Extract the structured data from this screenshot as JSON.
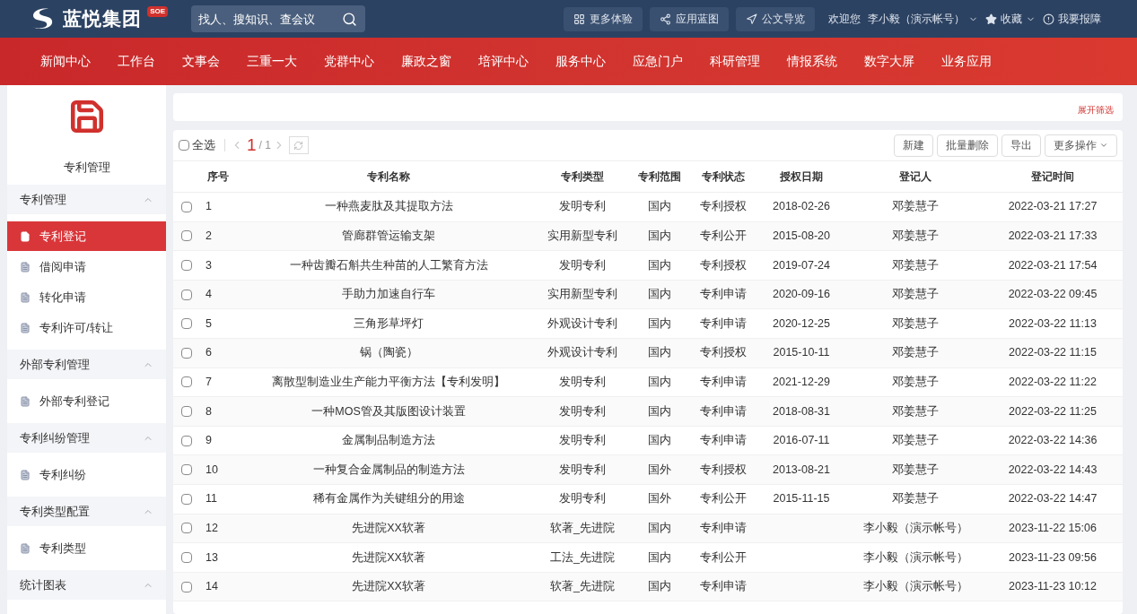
{
  "header": {
    "brand": "蓝悦集团",
    "brand_badge": "SOE",
    "search": {
      "placeholder": "找人、搜知识、查会议"
    },
    "tools": [
      {
        "label": "更多体验",
        "kind": "grid"
      },
      {
        "label": "应用蓝图",
        "kind": "nodes"
      },
      {
        "label": "公文导览",
        "kind": "nav"
      }
    ],
    "welcome": "欢迎您",
    "user": "李小毅（演示帐号）",
    "favorites": "收藏",
    "report": "我要报障"
  },
  "nav": [
    {
      "label": "新闻中心"
    },
    {
      "label": "工作台"
    },
    {
      "label": "文事会"
    },
    {
      "label": "三重一大"
    },
    {
      "label": "党群中心"
    },
    {
      "label": "廉政之窗"
    },
    {
      "label": "培评中心"
    },
    {
      "label": "服务中心"
    },
    {
      "label": "应急门户"
    },
    {
      "label": "科研管理"
    },
    {
      "label": "情报系统"
    },
    {
      "label": "数字大屏"
    },
    {
      "label": "业务应用"
    }
  ],
  "sidebar": {
    "title": "专利管理",
    "groups": [
      {
        "label": "专利管理",
        "expanded": true,
        "items": [
          {
            "label": "专利登记",
            "selected": true
          },
          {
            "label": "借阅申请",
            "selected": false
          },
          {
            "label": "转化申请",
            "selected": false
          },
          {
            "label": "专利许可/转让",
            "selected": false
          }
        ]
      },
      {
        "label": "外部专利管理",
        "expanded": true,
        "items": [
          {
            "label": "外部专利登记",
            "selected": false
          }
        ]
      },
      {
        "label": "专利纠纷管理",
        "expanded": true,
        "items": [
          {
            "label": "专利纠纷",
            "selected": false
          }
        ]
      },
      {
        "label": "专利类型配置",
        "expanded": true,
        "items": [
          {
            "label": "专利类型",
            "selected": false
          }
        ]
      },
      {
        "label": "统计图表",
        "expanded": true
      }
    ]
  },
  "filter": {
    "toggle": "展开筛选"
  },
  "toolbar": {
    "select_all": {
      "label": "全选",
      "checked": false
    },
    "page": "1",
    "total_pages": "/ 1",
    "buttons": [
      {
        "label": "新建",
        "dropdown": false
      },
      {
        "label": "批量删除",
        "dropdown": false
      },
      {
        "label": "导出",
        "dropdown": false
      },
      {
        "label": "更多操作",
        "dropdown": true
      }
    ]
  },
  "table": {
    "columns": [
      "序号",
      "专利名称",
      "专利类型",
      "专利范围",
      "专利状态",
      "授权日期",
      "登记人",
      "登记时间"
    ],
    "rows": [
      {
        "checked": false,
        "cells": [
          "1",
          "一种燕麦肽及其提取方法",
          "发明专利",
          "国内",
          "专利授权",
          "2018-02-26",
          "邓姜慧子",
          "2022-03-21 17:27"
        ]
      },
      {
        "checked": false,
        "cells": [
          "2",
          "管廊群管运输支架",
          "实用新型专利",
          "国内",
          "专利公开",
          "2015-08-20",
          "邓姜慧子",
          "2022-03-21 17:33"
        ]
      },
      {
        "checked": false,
        "cells": [
          "3",
          "一种齿瓣石斛共生种苗的人工繁育方法",
          "发明专利",
          "国内",
          "专利授权",
          "2019-07-24",
          "邓姜慧子",
          "2022-03-21 17:54"
        ]
      },
      {
        "checked": false,
        "cells": [
          "4",
          "手助力加速自行车",
          "实用新型专利",
          "国内",
          "专利申请",
          "2020-09-16",
          "邓姜慧子",
          "2022-03-22 09:45"
        ]
      },
      {
        "checked": false,
        "cells": [
          "5",
          "三角形草坪灯",
          "外观设计专利",
          "国内",
          "专利申请",
          "2020-12-25",
          "邓姜慧子",
          "2022-03-22 11:13"
        ]
      },
      {
        "checked": false,
        "cells": [
          "6",
          "锅（陶瓷）",
          "外观设计专利",
          "国内",
          "专利授权",
          "2015-10-11",
          "邓姜慧子",
          "2022-03-22 11:15"
        ]
      },
      {
        "checked": false,
        "cells": [
          "7",
          "离散型制造业生产能力平衡方法【专利发明】",
          "发明专利",
          "国内",
          "专利申请",
          "2021-12-29",
          "邓姜慧子",
          "2022-03-22 11:22"
        ]
      },
      {
        "checked": false,
        "cells": [
          "8",
          "一种MOS管及其版图设计装置",
          "发明专利",
          "国内",
          "专利申请",
          "2018-08-31",
          "邓姜慧子",
          "2022-03-22 11:25"
        ]
      },
      {
        "checked": false,
        "cells": [
          "9",
          "金属制品制造方法",
          "发明专利",
          "国内",
          "专利申请",
          "2016-07-11",
          "邓姜慧子",
          "2022-03-22 14:36"
        ]
      },
      {
        "checked": false,
        "cells": [
          "10",
          "一种复合金属制品的制造方法",
          "发明专利",
          "国外",
          "专利授权",
          "2013-08-21",
          "邓姜慧子",
          "2022-03-22 14:43"
        ]
      },
      {
        "checked": false,
        "cells": [
          "11",
          "稀有金属作为关键组分的用途",
          "发明专利",
          "国外",
          "专利公开",
          "2015-11-15",
          "邓姜慧子",
          "2022-03-22 14:47"
        ]
      },
      {
        "checked": false,
        "cells": [
          "12",
          "先进院XX软著",
          "软著_先进院",
          "国内",
          "专利申请",
          "",
          "李小毅（演示帐号）",
          "2023-11-22 15:06"
        ]
      },
      {
        "checked": false,
        "cells": [
          "13",
          "先进院XX软著",
          "工法_先进院",
          "国内",
          "专利公开",
          "",
          "李小毅（演示帐号）",
          "2023-11-23 09:56"
        ]
      },
      {
        "checked": false,
        "cells": [
          "14",
          "先进院XX软著",
          "软著_先进院",
          "国内",
          "专利申请",
          "",
          "李小毅（演示帐号）",
          "2023-11-23 10:12"
        ]
      }
    ]
  }
}
